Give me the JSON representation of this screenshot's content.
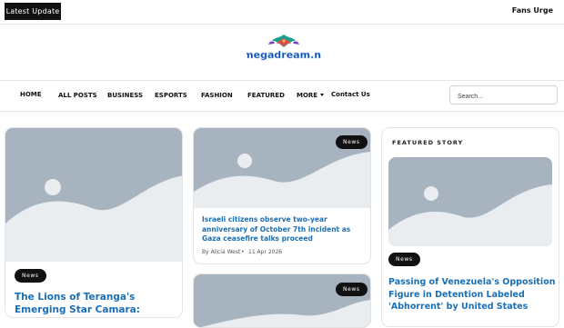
{
  "header": {
    "latest_update": "Latest Update",
    "fans_urge": "Fans Urge",
    "logo_text": "megadream.nl"
  },
  "nav": {
    "items": [
      {
        "label": "HOME"
      },
      {
        "label": "ALL POSTS"
      },
      {
        "label": "BUSINESS"
      },
      {
        "label": "ESPORTS"
      },
      {
        "label": "FASHION"
      },
      {
        "label": "FEATURED"
      },
      {
        "label": "MORE"
      },
      {
        "label": "Contact Us"
      }
    ]
  },
  "search": {
    "placeholder": "Search..."
  },
  "posts": {
    "left": {
      "tag": "News",
      "title": "The Lions of Teranga's Emerging Star Camara: Starting from"
    },
    "middle_top": {
      "tag": "News",
      "title": "Israeli citizens observe two-year anniversary of October 7th incident as Gaza ceasefire talks proceed",
      "author": "By Alicia West",
      "date": "11 Apr 2026"
    },
    "middle_bottom": {
      "tag": "News"
    }
  },
  "featured": {
    "label": "FEATURED STORY",
    "tag": "News",
    "title": "Passing of Venezuela's Opposition Figure in Detention Labeled 'Abhorrent' by United States"
  },
  "colors": {
    "link": "#1b6fb5",
    "placeholder_bg": "#a7b4c0",
    "placeholder_fg": "#e9edf0",
    "logo_text": "#1a3ea8"
  }
}
